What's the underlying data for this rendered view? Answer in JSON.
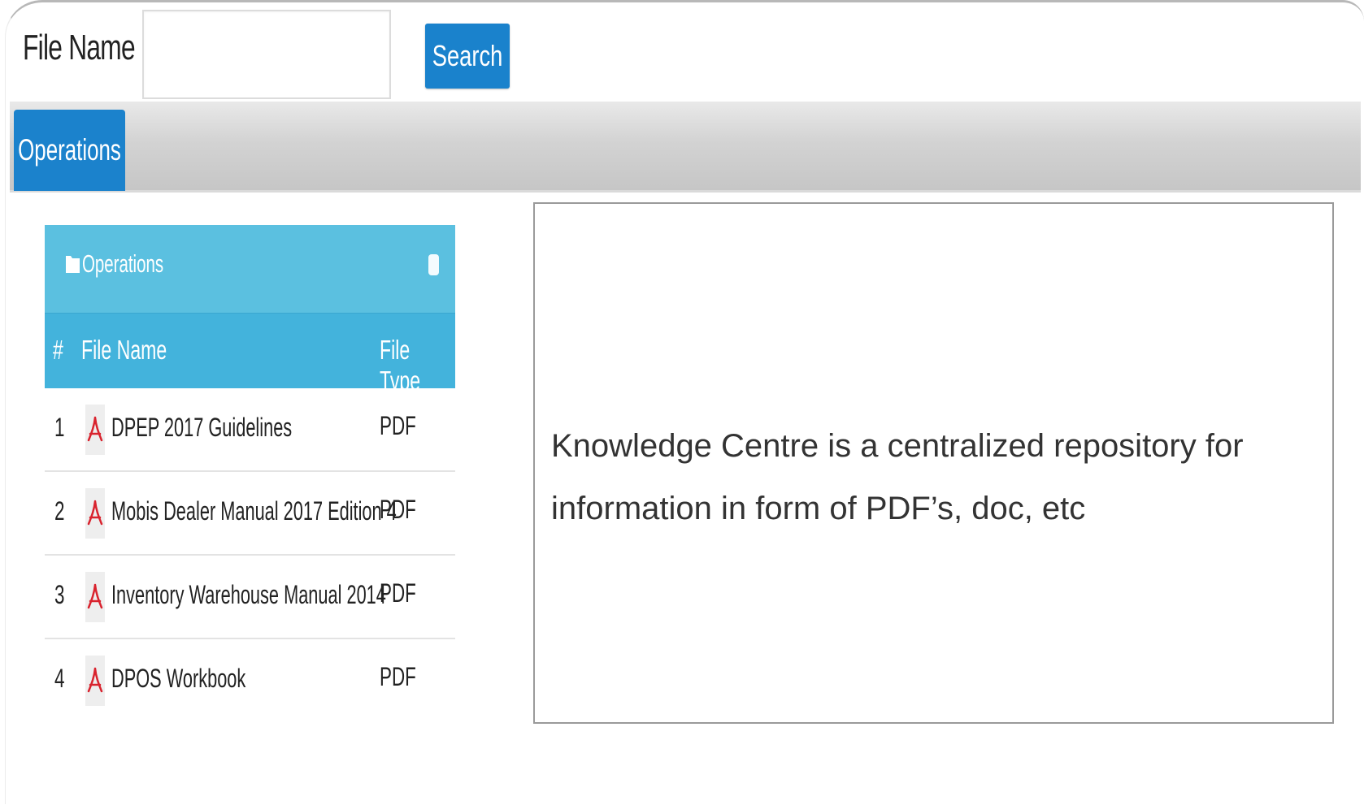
{
  "search": {
    "label": "File Name",
    "input_value": "",
    "input_placeholder": "",
    "button_label": "Search"
  },
  "tabs": [
    {
      "label": "Operations",
      "active": true
    }
  ],
  "panel": {
    "title": "Operations",
    "icon": "folder-icon",
    "columns": [
      "#",
      "File Name",
      "File Type"
    ],
    "rows": [
      {
        "num": "1",
        "name": "DPEP 2017 Guidelines",
        "type": "PDF",
        "icon": "pdf-icon"
      },
      {
        "num": "2",
        "name": "Mobis Dealer Manual 2017 Edition 4",
        "type": "PDF",
        "icon": "pdf-icon"
      },
      {
        "num": "3",
        "name": "Inventory Warehouse Manual 2014",
        "type": "PDF",
        "icon": "pdf-icon"
      },
      {
        "num": "4",
        "name": "DPOS Workbook",
        "type": "PDF",
        "icon": "pdf-icon"
      }
    ]
  },
  "info": {
    "text": "Knowledge Centre is a centralized repository for information in form of PDF’s, doc, etc"
  },
  "colors": {
    "primary": "#1a82cc",
    "panel_header": "#5bc0e0",
    "table_header": "#43b3dc",
    "pdf_red": "#d9232e"
  }
}
